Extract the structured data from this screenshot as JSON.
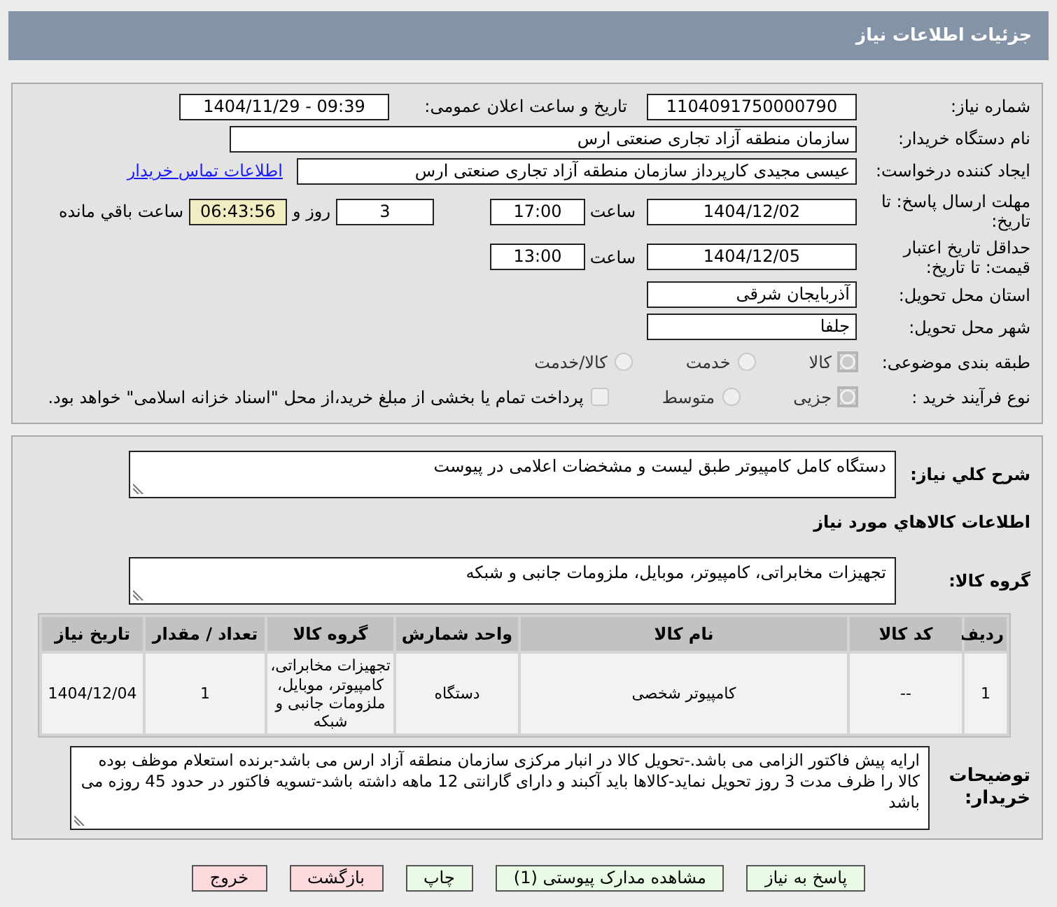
{
  "header": {
    "title": "جزئیات اطلاعات نیاز"
  },
  "need_number": {
    "label": "شماره نیاز:",
    "value": "1104091750000790"
  },
  "announce": {
    "label": "تاریخ و ساعت اعلان عمومی:",
    "value": "1404/11/29 - 09:39"
  },
  "buyer_org": {
    "label": "نام دستگاه خریدار:",
    "value": "سازمان منطقه آزاد تجاری صنعتی ارس"
  },
  "requester": {
    "label": "ایجاد کننده درخواست:",
    "value": "عیسی مجیدی کارپرداز سازمان منطقه آزاد تجاری صنعتی ارس",
    "link": "اطلاعات تماس خریدار"
  },
  "reply_deadline": {
    "label": "مهلت ارسال پاسخ: تا تاریخ:",
    "date": "1404/12/02",
    "time_label": "ساعت",
    "time": "17:00",
    "days": "3",
    "days_label": "روز و",
    "remaining": "06:43:56",
    "remaining_label": "ساعت باقي مانده"
  },
  "price_validity": {
    "label": "حداقل تاریخ اعتبار قیمت: تا تاریخ:",
    "date": "1404/12/05",
    "time_label": "ساعت",
    "time": "13:00"
  },
  "province": {
    "label": "استان محل تحویل:",
    "value": "آذربایجان شرقی"
  },
  "city": {
    "label": "شهر محل تحویل:",
    "value": "جلفا"
  },
  "category": {
    "label": "طبقه بندی موضوعی:",
    "options": [
      {
        "label": "کالا",
        "selected": true
      },
      {
        "label": "خدمت",
        "selected": false
      },
      {
        "label": "کالا/خدمت",
        "selected": false
      }
    ]
  },
  "process": {
    "label": "نوع فرآیند خرید :",
    "options": [
      {
        "label": "جزیی",
        "selected": true
      },
      {
        "label": "متوسط",
        "selected": false
      }
    ],
    "payment": {
      "checked": false,
      "label": "پرداخت تمام یا بخشی از مبلغ خرید،از محل \"اسناد خزانه اسلامی\" خواهد بود."
    }
  },
  "description": {
    "label": "شرح كلي نياز:",
    "value": "دستگاه کامل کامپیوتر طبق لیست و مشخضات اعلامی در پیوست"
  },
  "goods_title": "اطلاعات كالاهاي مورد نياز",
  "goods_group": {
    "label": "گروه کالا:",
    "value": "تجهیزات مخابراتی، کامپیوتر، موبایل، ملزومات جانبی و شبکه"
  },
  "table": {
    "columns": [
      "ردیف",
      "کد کالا",
      "نام کالا",
      "واحد شمارش",
      "گروه کالا",
      "تعداد / مقدار",
      "تاریخ نیاز"
    ],
    "rows": [
      [
        "1",
        "--",
        "کامپیوتر شخصی",
        "دستگاه",
        "تجهیزات مخابراتی، کامپیوتر، موبایل، ملزومات جانبی و شبکه",
        "1",
        "1404/12/04"
      ]
    ]
  },
  "buyer_notes": {
    "label": "توضیحات خریدار:",
    "value": "ارایه پیش فاکتور الزامی می باشد.-تحویل کالا در انبار مرکزی سازمان منطقه آزاد ارس می باشد-برنده استعلام موظف بوده کالا را ظرف مدت 3 روز تحویل نماید-کالاها باید آکبند و دارای گارانتی 12 ماهه داشته باشد-تسویه فاکتور در حدود 45 روزه می باشد"
  },
  "buttons": [
    {
      "label": "پاسخ به نیاز",
      "kind": "ok"
    },
    {
      "label": "مشاهده مدارک پیوستی (1)",
      "kind": "ok"
    },
    {
      "label": "چاپ",
      "kind": "ok"
    },
    {
      "label": "بازگشت",
      "kind": "exit"
    },
    {
      "label": "خروج",
      "kind": "exit"
    }
  ]
}
